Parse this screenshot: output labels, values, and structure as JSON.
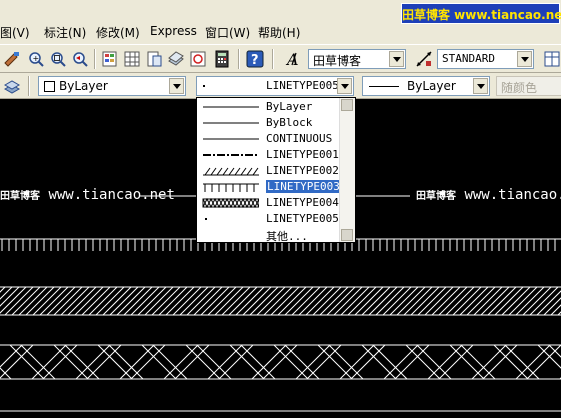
{
  "menu": {
    "items": [
      {
        "label": "图(V)"
      },
      {
        "label": "标注(N)"
      },
      {
        "label": "修改(M)"
      },
      {
        "label": "Express"
      },
      {
        "label": "窗口(W)"
      },
      {
        "label": "帮助(H)"
      }
    ]
  },
  "brand_badge": "田草博客 www.tiancao.net",
  "toolbar1": {
    "text_style_value": "田草博客",
    "dim_style_value": "STANDARD"
  },
  "toolbar2": {
    "layer_value": "ByLayer",
    "linetype_value": "LINETYPE005",
    "lineweight_value": "ByLayer",
    "plotstyle_value": "随颜色"
  },
  "linetype_dropdown": {
    "items": [
      {
        "label": "ByLayer",
        "pattern": "solid"
      },
      {
        "label": "ByBlock",
        "pattern": "solid"
      },
      {
        "label": "CONTINUOUS",
        "pattern": "solid"
      },
      {
        "label": "LINETYPE001",
        "pattern": "dashdot"
      },
      {
        "label": "LINETYPE002",
        "pattern": "hatch"
      },
      {
        "label": "LINETYPE003",
        "pattern": "ticks",
        "selected": true
      },
      {
        "label": "LINETYPE004",
        "pattern": "zigzag"
      },
      {
        "label": "LINETYPE005",
        "pattern": "dot"
      },
      {
        "label": "其他...",
        "pattern": "none"
      }
    ]
  },
  "canvas": {
    "watermark_left_cn": "田草博客",
    "watermark_left_url": "www.tiancao.net",
    "watermark_right_cn": "田草博客",
    "watermark_right_url": "www.tiancao.ne"
  },
  "colors": {
    "chrome": "#ECE9D8",
    "selection": "#316AC5",
    "brand_bg": "#1D3FB8",
    "brand_text": "#FFE400"
  }
}
